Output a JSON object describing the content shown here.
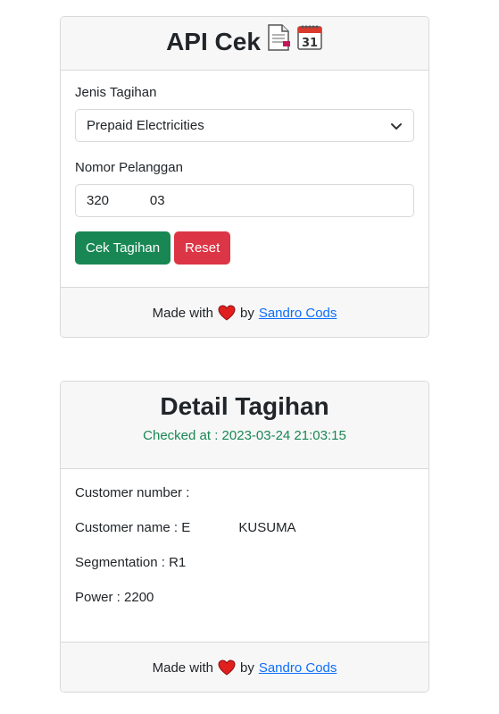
{
  "api_card": {
    "title": "API Cek",
    "bill_type_label": "Jenis Tagihan",
    "bill_type_value": "Prepaid Electricities",
    "customer_no_label": "Nomor Pelanggan",
    "customer_no_value": "320           03",
    "check_button": "Cek Tagihan",
    "reset_button": "Reset",
    "footer_made_with": "Made with",
    "footer_by": "by",
    "footer_link": "Sandro Cods"
  },
  "detail_card": {
    "title": "Detail Tagihan",
    "checked_at": "Checked at : 2023-03-24 21:03:15",
    "rows": [
      "Customer number :",
      "Customer name : E             KUSUMA",
      "Segmentation : R1",
      "Power : 2200"
    ],
    "footer_made_with": "Made with",
    "footer_by": "by",
    "footer_link": "Sandro Cods"
  },
  "icons": [
    "page-facing-up-icon",
    "calendar-icon",
    "heart-icon",
    "chevron-down-icon"
  ],
  "colors": {
    "success": "#198754",
    "danger": "#dc3545",
    "link": "#0d6efd",
    "heart": "#e0201e"
  }
}
